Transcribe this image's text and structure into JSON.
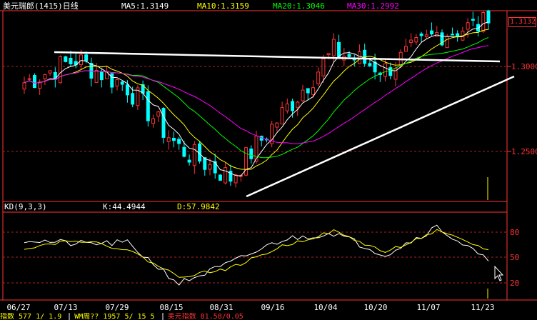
{
  "header": {
    "title": "美元瑞郎(1415)日线",
    "ma5": "MA5:1.3149",
    "ma10": "MA10:1.3159",
    "ma20": "MA20:1.3046",
    "ma30": "MA30:1.2992"
  },
  "price_axis": {
    "current": "1.3132",
    "labels": [
      "1.3000",
      "1.2500"
    ]
  },
  "kd_header": {
    "name": "KD(9,3,3)",
    "k": "K:44.4944",
    "d": "D:57.9842"
  },
  "kd_axis": {
    "labels": [
      "80",
      "50",
      "20"
    ]
  },
  "dates": [
    "06/27",
    "07/13",
    "07/29",
    "08/15",
    "08/31",
    "09/16",
    "10/04",
    "10/20",
    "11/07",
    "11/23"
  ],
  "status_bar": {
    "item1": "指数 577 1/ 1.9",
    "item2": "WM周??  1957 5/ 15 5",
    "item3": "美元指数 81.58/0.05"
  },
  "colors": {
    "up": "#ff3333",
    "down": "#00ffff",
    "ma5": "#ffffff",
    "ma10": "#ffff00",
    "ma20": "#00ff00",
    "ma30": "#ff00ff",
    "k_line": "#ffffff",
    "d_line": "#ffff00"
  },
  "chart_data": [
    {
      "type": "candlestick",
      "title": "美元瑞郎(1415)日线",
      "x": [
        "06/27",
        "07/13",
        "07/29",
        "08/15",
        "08/31",
        "09/16",
        "10/04",
        "10/20",
        "11/07",
        "11/23"
      ],
      "close": [
        1.285,
        1.296,
        1.283,
        1.254,
        1.24,
        1.27,
        1.3,
        1.291,
        1.308,
        1.3132
      ],
      "ylim": [
        1.23,
        1.318
      ],
      "moving_averages": {
        "MA5": 1.3149,
        "MA10": 1.3159,
        "MA20": 1.3046,
        "MA30": 1.2992
      },
      "trendlines": [
        {
          "from": [
            "06/27",
            1.308
          ],
          "to": [
            "11/23",
            1.301
          ]
        },
        {
          "from": [
            "08/31",
            1.236
          ],
          "to": [
            "11/23",
            1.296
          ]
        }
      ]
    },
    {
      "type": "line",
      "title": "KD(9,3,3)",
      "x": [
        "06/27",
        "07/13",
        "07/29",
        "08/15",
        "08/31",
        "09/16",
        "10/04",
        "10/20",
        "11/07",
        "11/23"
      ],
      "series": [
        {
          "name": "K",
          "values": [
            70,
            65,
            66,
            18,
            42,
            70,
            78,
            52,
            85,
            44.4944
          ]
        },
        {
          "name": "D",
          "values": [
            60,
            70,
            58,
            26,
            36,
            62,
            80,
            55,
            80,
            57.9842
          ]
        }
      ],
      "ylim": [
        0,
        100
      ]
    }
  ]
}
